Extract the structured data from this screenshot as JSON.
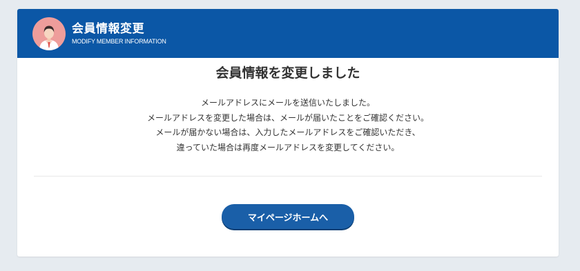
{
  "header": {
    "title": "会員情報変更",
    "subtitle": "MODIFY MEMBER INFORMATION",
    "background_color": "#0b57a6",
    "avatar_icon": "member-person-icon",
    "avatar_color": "#ee9d9b"
  },
  "main": {
    "heading": "会員情報を変更しました",
    "message_lines": [
      "メールアドレスにメールを送信いたしました。",
      "メールアドレスを変更した場合は、メールが届いたことをご確認ください。",
      "メールが届かない場合は、入力したメールアドレスをご確認いただき、",
      "違っていた場合は再度メールアドレスを変更してください。"
    ]
  },
  "actions": {
    "home_button_label": "マイページホームへ",
    "button_color": "#1a5fa8"
  }
}
